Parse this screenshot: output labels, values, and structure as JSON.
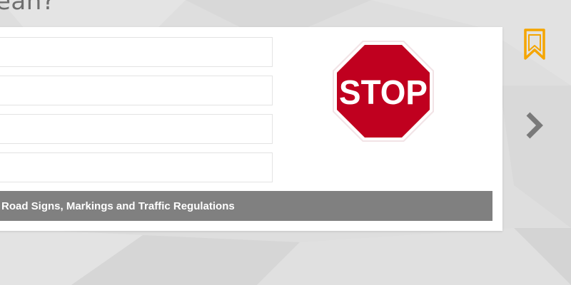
{
  "question": {
    "heading_fragment": "ean?"
  },
  "answers": [
    {
      "text": ""
    },
    {
      "text": ""
    },
    {
      "text": ""
    },
    {
      "text": ""
    }
  ],
  "sign": {
    "text": "STOP",
    "colors": {
      "red": "#c0001f",
      "white": "#ffffff"
    }
  },
  "category": {
    "label": "Road Signs, Markings and Traffic Regulations",
    "background": "#808080"
  },
  "actions": {
    "bookmark_icon": "bookmark-icon",
    "bookmark_color": "#f5a500",
    "next_icon": "chevron-right-icon",
    "next_color": "#7a7a7a"
  }
}
